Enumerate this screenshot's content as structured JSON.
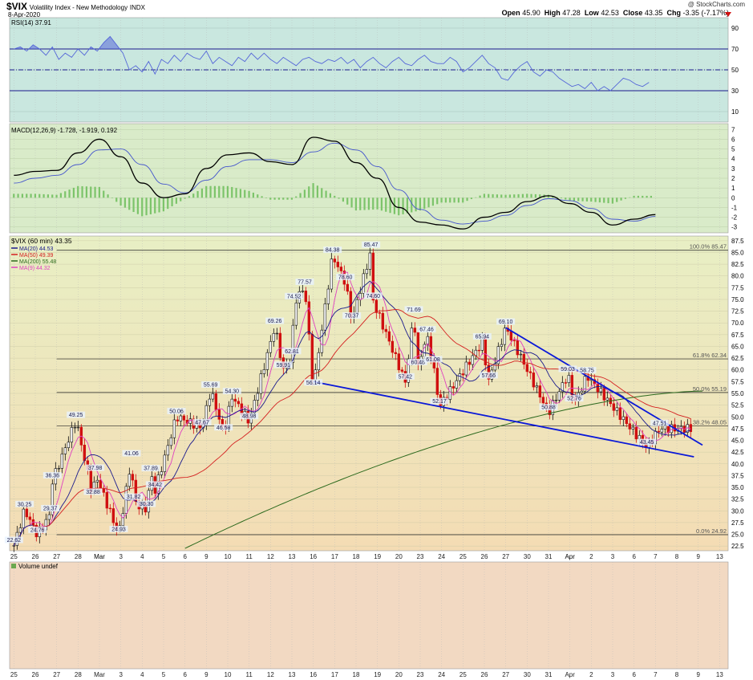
{
  "header": {
    "symbol": "$VIX",
    "name": "Volatility Index - New Methodology",
    "exchange": "INDX",
    "date": "8-Apr-2020",
    "copyright": "@ StockCharts.com",
    "quote": {
      "open_label": "Open",
      "open": "45.90",
      "high_label": "High",
      "high": "47.28",
      "low_label": "Low",
      "low": "42.53",
      "close_label": "Close",
      "close": "43.35",
      "chg_label": "Chg",
      "chg": "-3.35 (-7.17%)"
    }
  },
  "colors": {
    "rsi_bg": "#c9e7df",
    "macd_bg": "#d9ebc9",
    "price_bg_top": "#e8efc4",
    "price_bg_bottom": "#f4dcb4",
    "volume_bg": "#f2d9c2",
    "up_candle": "#111111",
    "down_candle": "#d01010",
    "rsi_line": "#5566d8",
    "macd_line": "#000000",
    "signal_line": "#4455cc",
    "hist": "#7cc46a",
    "ma20": "#1a1a8c",
    "ma50": "#d42020",
    "ma200": "#2d6a1e",
    "ma9": "#e040c0",
    "trend": "#0a18d8"
  },
  "chart_data": [
    {
      "panel": "rsi",
      "type": "line",
      "title": "RSI(14) 37.91",
      "yticks": [
        90,
        70,
        50,
        30,
        10
      ],
      "ylim": [
        0,
        100
      ],
      "reference_lines": [
        70,
        50,
        30
      ],
      "series": [
        {
          "x": [
            0,
            3,
            6,
            9,
            12,
            15,
            18,
            21,
            24,
            27,
            30,
            33,
            36,
            39,
            42,
            45,
            48,
            51,
            54,
            57,
            60,
            63,
            66,
            69,
            72,
            75,
            78,
            81,
            84,
            87,
            90,
            93,
            96,
            99,
            102,
            105,
            108,
            111,
            114,
            117,
            120,
            123,
            126,
            129,
            132,
            135,
            138,
            141,
            144,
            147,
            150,
            153,
            156,
            159,
            162,
            165,
            168,
            171,
            174,
            177,
            180,
            183,
            186,
            189,
            192,
            195,
            198,
            201,
            204,
            207,
            210,
            213,
            216,
            219,
            222,
            225,
            228,
            231,
            234,
            237,
            240,
            243,
            246,
            249,
            252,
            255,
            258,
            261,
            264,
            267,
            270,
            273,
            276,
            279,
            282,
            285,
            288,
            291,
            294,
            297
          ],
          "values": [
            70,
            72,
            68,
            74,
            70,
            64,
            72,
            60,
            66,
            62,
            70,
            64,
            72,
            68,
            76,
            82,
            74,
            66,
            50,
            54,
            48,
            58,
            46,
            60,
            56,
            64,
            58,
            66,
            62,
            60,
            68,
            56,
            62,
            58,
            54,
            62,
            58,
            66,
            60,
            66,
            60,
            56,
            62,
            58,
            54,
            60,
            62,
            58,
            56,
            60,
            58,
            62,
            56,
            60,
            52,
            58,
            62,
            56,
            52,
            58,
            62,
            56,
            54,
            60,
            64,
            58,
            56,
            56,
            62,
            58,
            48,
            52,
            58,
            64,
            56,
            52,
            42,
            40,
            48,
            54,
            58,
            48,
            44,
            50,
            48,
            42,
            38,
            34,
            36,
            32,
            38,
            30,
            34,
            30,
            36,
            42,
            40,
            36,
            34,
            38
          ]
        }
      ]
    },
    {
      "panel": "macd",
      "type": "line",
      "title": "MACD(12,26,9) -1.728, -1.919, 0.192",
      "yticks": [
        7,
        6,
        5,
        4,
        3,
        2,
        1,
        0,
        -1,
        -2,
        -3
      ],
      "ylim": [
        -3.6,
        7.6
      ],
      "series": [
        {
          "name": "MACD",
          "x": [
            0,
            10,
            20,
            30,
            40,
            50,
            60,
            70,
            80,
            90,
            100,
            110,
            120,
            130,
            140,
            150,
            160,
            170,
            180,
            190,
            200,
            210,
            220,
            230,
            240,
            250,
            260,
            270,
            280,
            290,
            300
          ],
          "values": [
            2.3,
            2.7,
            2.8,
            4.6,
            6.0,
            4.2,
            1.5,
            0.0,
            0.4,
            3.0,
            4.4,
            4.6,
            3.7,
            3.4,
            6.2,
            5.8,
            3.6,
            2.0,
            -1.0,
            -2.5,
            -2.8,
            -3.2,
            -2.0,
            -1.5,
            -0.4,
            0.2,
            -0.6,
            -1.5,
            -2.8,
            -2.2,
            -1.73
          ]
        },
        {
          "name": "Signal",
          "x": [
            0,
            10,
            20,
            30,
            40,
            50,
            60,
            70,
            80,
            90,
            100,
            110,
            120,
            130,
            140,
            150,
            160,
            170,
            180,
            190,
            200,
            210,
            220,
            230,
            240,
            250,
            260,
            270,
            280,
            290,
            300
          ],
          "values": [
            1.5,
            2.0,
            2.3,
            3.4,
            4.9,
            5.0,
            3.4,
            1.4,
            0.5,
            1.8,
            3.2,
            3.9,
            3.9,
            3.6,
            4.7,
            5.6,
            4.9,
            3.2,
            0.8,
            -1.2,
            -2.3,
            -2.7,
            -2.4,
            -1.8,
            -0.8,
            -0.1,
            -0.3,
            -1.1,
            -2.2,
            -2.4,
            -1.92
          ]
        },
        {
          "name": "Histogram",
          "x": [
            0,
            10,
            20,
            30,
            40,
            50,
            60,
            70,
            80,
            90,
            100,
            110,
            120,
            130,
            140,
            150,
            160,
            170,
            180,
            190,
            200,
            210,
            220,
            230,
            240,
            250,
            260,
            270,
            280,
            290,
            300
          ],
          "values": [
            0.4,
            0.4,
            0.3,
            1.2,
            1.1,
            -0.8,
            -1.9,
            -1.4,
            -0.1,
            1.2,
            1.2,
            0.7,
            -0.2,
            -0.2,
            1.5,
            0.2,
            -1.3,
            -1.2,
            -1.8,
            -1.3,
            -0.5,
            -0.5,
            0.4,
            0.3,
            0.4,
            0.3,
            -0.3,
            -0.4,
            -0.6,
            0.2,
            0.19
          ]
        }
      ]
    },
    {
      "panel": "price",
      "type": "candlestick",
      "title": "$VIX (60 min) 43.35",
      "legend": [
        {
          "label": "MA(20) 44.53",
          "color_key": "ma20"
        },
        {
          "label": "MA(50) 49.39",
          "color_key": "ma50"
        },
        {
          "label": "MA(200) 55.48",
          "color_key": "ma200"
        },
        {
          "label": "MA(9) 44.32",
          "color_key": "ma9"
        }
      ],
      "yticks": [
        87.5,
        85.0,
        82.5,
        80.0,
        77.5,
        75.0,
        72.5,
        70.0,
        67.5,
        65.0,
        62.5,
        60.0,
        57.5,
        55.0,
        52.5,
        50.0,
        47.5,
        45.0,
        42.5,
        40.0,
        37.5,
        35.0,
        32.5,
        30.0,
        27.5,
        25.0,
        22.5
      ],
      "ylim": [
        21.5,
        88.5
      ],
      "xticks": [
        {
          "x": 0,
          "label": "25"
        },
        {
          "x": 10,
          "label": "26"
        },
        {
          "x": 20,
          "label": "27"
        },
        {
          "x": 30,
          "label": "28"
        },
        {
          "x": 40,
          "label": "Mar"
        },
        {
          "x": 50,
          "label": "3"
        },
        {
          "x": 60,
          "label": "4"
        },
        {
          "x": 70,
          "label": "5"
        },
        {
          "x": 80,
          "label": "6"
        },
        {
          "x": 90,
          "label": "9"
        },
        {
          "x": 100,
          "label": "10"
        },
        {
          "x": 110,
          "label": "11"
        },
        {
          "x": 120,
          "label": "12"
        },
        {
          "x": 130,
          "label": "13"
        },
        {
          "x": 140,
          "label": "16"
        },
        {
          "x": 150,
          "label": "17"
        },
        {
          "x": 160,
          "label": "18"
        },
        {
          "x": 170,
          "label": "19"
        },
        {
          "x": 180,
          "label": "20"
        },
        {
          "x": 190,
          "label": "23"
        },
        {
          "x": 200,
          "label": "24"
        },
        {
          "x": 210,
          "label": "25"
        },
        {
          "x": 220,
          "label": "26"
        },
        {
          "x": 230,
          "label": "27"
        },
        {
          "x": 240,
          "label": "30"
        },
        {
          "x": 250,
          "label": "31"
        },
        {
          "x": 260,
          "label": "Apr"
        },
        {
          "x": 270,
          "label": "2"
        },
        {
          "x": 280,
          "label": "3"
        },
        {
          "x": 290,
          "label": "6"
        },
        {
          "x": 300,
          "label": "7"
        },
        {
          "x": 310,
          "label": "8"
        },
        {
          "x": 320,
          "label": "9"
        },
        {
          "x": 330,
          "label": "13"
        }
      ],
      "xlim": [
        -2,
        334
      ],
      "fib_levels": [
        {
          "value": 85.47,
          "label": "100.0% 85.47"
        },
        {
          "value": 62.34,
          "label": "61.8% 62.34"
        },
        {
          "value": 55.19,
          "label": "50.0% 55.19"
        },
        {
          "value": 48.05,
          "label": "38.2% 48.05"
        },
        {
          "value": 24.92,
          "label": "0.0% 24.92"
        }
      ],
      "trendlines": [
        {
          "x1": 140,
          "y1": 57.5,
          "x2": 318,
          "y2": 41.5
        },
        {
          "x1": 230,
          "y1": 69.0,
          "x2": 322,
          "y2": 44.0
        }
      ],
      "annotations": [
        {
          "x": 0,
          "y": 22.62,
          "label": "22.62"
        },
        {
          "x": 5,
          "y": 30.25,
          "label": "30.25"
        },
        {
          "x": 11,
          "y": 24.76,
          "label": "24.76"
        },
        {
          "x": 17,
          "y": 29.37,
          "label": "29.37"
        },
        {
          "x": 18,
          "y": 36.36,
          "label": "36.36"
        },
        {
          "x": 29,
          "y": 49.25,
          "label": "49.25"
        },
        {
          "x": 38,
          "y": 37.98,
          "label": "37.98"
        },
        {
          "x": 37,
          "y": 32.88,
          "label": "32.88"
        },
        {
          "x": 49,
          "y": 24.93,
          "label": "24.93"
        },
        {
          "x": 55,
          "y": 41.06,
          "label": "41.06"
        },
        {
          "x": 56,
          "y": 31.82,
          "label": "31.82"
        },
        {
          "x": 62,
          "y": 30.3,
          "label": "30.30"
        },
        {
          "x": 64,
          "y": 37.89,
          "label": "37.89"
        },
        {
          "x": 66,
          "y": 34.42,
          "label": "34.42"
        },
        {
          "x": 76,
          "y": 50.06,
          "label": "50.06"
        },
        {
          "x": 88,
          "y": 47.67,
          "label": "47.67"
        },
        {
          "x": 92,
          "y": 55.69,
          "label": "55.69"
        },
        {
          "x": 102,
          "y": 54.3,
          "label": "54.30"
        },
        {
          "x": 98,
          "y": 46.58,
          "label": "46.58"
        },
        {
          "x": 110,
          "y": 48.98,
          "label": "48.98"
        },
        {
          "x": 126,
          "y": 59.91,
          "label": "59.91"
        },
        {
          "x": 122,
          "y": 69.26,
          "label": "69.26"
        },
        {
          "x": 130,
          "y": 62.81,
          "label": "62.81"
        },
        {
          "x": 131,
          "y": 74.52,
          "label": "74.52"
        },
        {
          "x": 136,
          "y": 77.57,
          "label": "77.57"
        },
        {
          "x": 140,
          "y": 56.14,
          "label": "56.14"
        },
        {
          "x": 149,
          "y": 84.38,
          "label": "84.38"
        },
        {
          "x": 155,
          "y": 78.6,
          "label": "78.60"
        },
        {
          "x": 158,
          "y": 70.37,
          "label": "70.37"
        },
        {
          "x": 167,
          "y": 85.47,
          "label": "85.47"
        },
        {
          "x": 168,
          "y": 74.6,
          "label": "74.60"
        },
        {
          "x": 187,
          "y": 71.69,
          "label": "71.69"
        },
        {
          "x": 193,
          "y": 67.46,
          "label": "67.46"
        },
        {
          "x": 183,
          "y": 57.42,
          "label": "57.42"
        },
        {
          "x": 189,
          "y": 60.48,
          "label": "60.48"
        },
        {
          "x": 196,
          "y": 61.08,
          "label": "61.08"
        },
        {
          "x": 199,
          "y": 52.17,
          "label": "52.17"
        },
        {
          "x": 219,
          "y": 65.94,
          "label": "65.94"
        },
        {
          "x": 222,
          "y": 57.66,
          "label": "57.66"
        },
        {
          "x": 230,
          "y": 69.1,
          "label": "69.10"
        },
        {
          "x": 250,
          "y": 50.88,
          "label": "50.88"
        },
        {
          "x": 259,
          "y": 59.03,
          "label": "59.03"
        },
        {
          "x": 268,
          "y": 58.75,
          "label": "58.75"
        },
        {
          "x": 262,
          "y": 52.76,
          "label": "52.76"
        },
        {
          "x": 302,
          "y": 47.51,
          "label": "47.51"
        },
        {
          "x": 296,
          "y": 43.45,
          "label": "43.45"
        }
      ]
    },
    {
      "panel": "volume",
      "type": "bar",
      "title": "Volume undef",
      "values": []
    }
  ]
}
